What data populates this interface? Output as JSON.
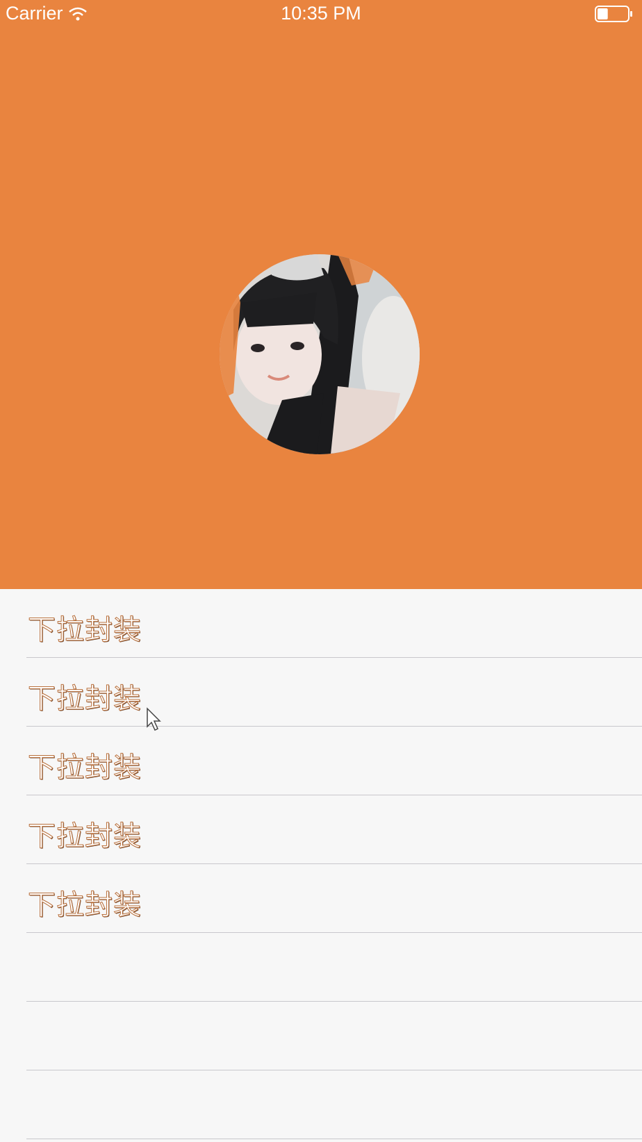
{
  "status_bar": {
    "carrier": "Carrier",
    "time": "10:35 PM",
    "battery_level": 0.35
  },
  "header": {
    "background_color": "#e9843f",
    "avatar": "avatar-photo"
  },
  "list": {
    "rows": [
      {
        "label": "下拉封装"
      },
      {
        "label": "下拉封装"
      },
      {
        "label": "下拉封装"
      },
      {
        "label": "下拉封装"
      },
      {
        "label": "下拉封装"
      },
      {
        "label": ""
      },
      {
        "label": ""
      },
      {
        "label": ""
      }
    ]
  },
  "icons": {
    "wifi": "wifi-icon",
    "battery": "battery-icon",
    "cursor": "mouse-pointer-icon"
  }
}
